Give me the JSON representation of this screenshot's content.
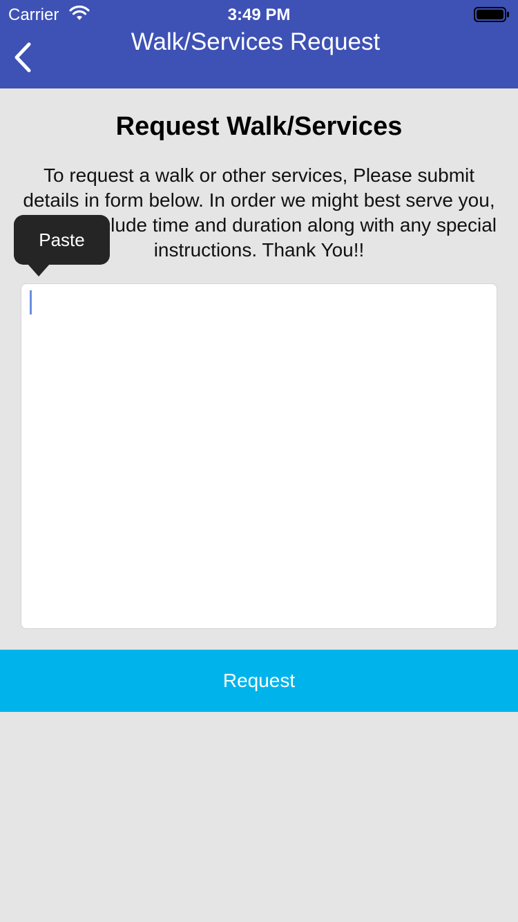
{
  "status_bar": {
    "carrier": "Carrier",
    "time": "3:49 PM"
  },
  "nav": {
    "back_icon": "chevron-left-icon",
    "title": "Walk/Services Request"
  },
  "main": {
    "title": "Request Walk/Services",
    "instructions": "To request a walk or other services, Please submit details in form below. In order we might best serve you, Please include time and duration along with any special instructions. Thank You!!",
    "textarea_value": ""
  },
  "context_menu": {
    "paste_label": "Paste"
  },
  "request_button_label": "Request",
  "colors": {
    "nav_bar": "#3e51b5",
    "background": "#e5e5e5",
    "request_button": "#00b4eb",
    "tooltip": "#252525",
    "caret": "#6b8de3"
  }
}
